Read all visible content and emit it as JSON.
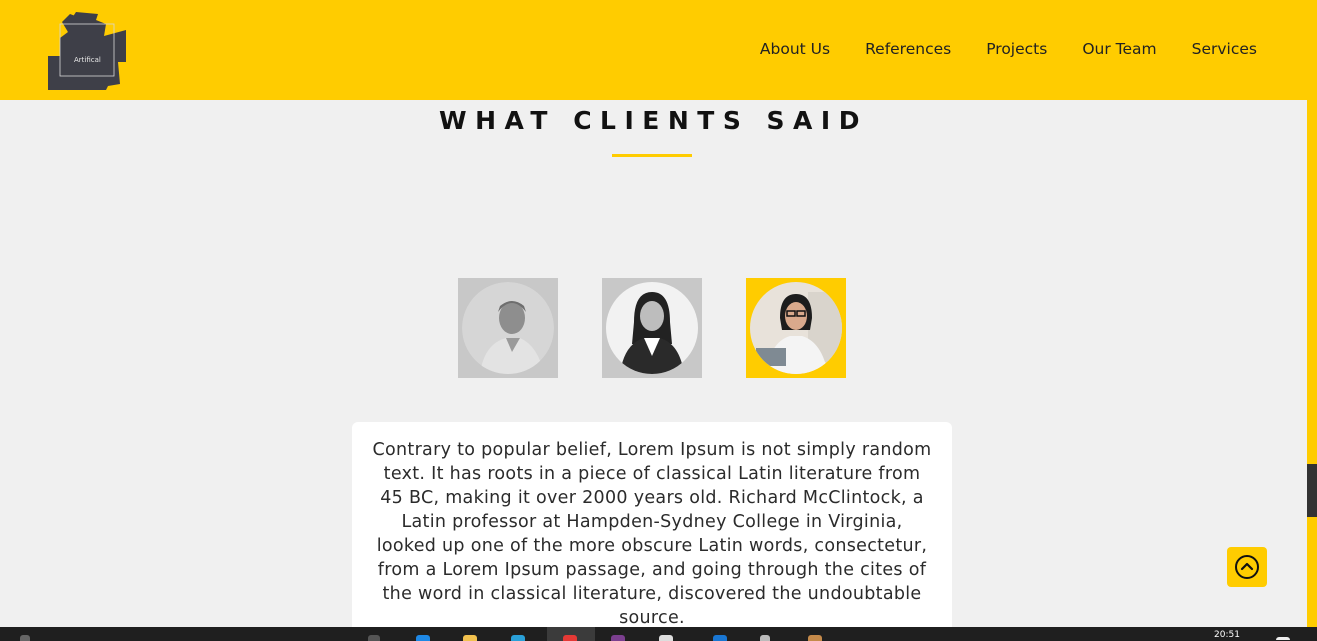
{
  "header": {
    "logo_text": "Artifical",
    "nav": [
      "About Us",
      "References",
      "Projects",
      "Our Team",
      "Services"
    ]
  },
  "section": {
    "title": "WHAT CLIENTS SAID"
  },
  "testimonials": {
    "active_index": 2,
    "quote": "Contrary to popular belief, Lorem Ipsum is not simply random text. It has roots in a piece of classical Latin literature from 45 BC, making it over 2000 years old. Richard McClintock, a Latin professor at Hampden-Sydney College in Virginia, looked up one of the more obscure Latin words, consectetur, from a Lorem Ipsum passage, and going through the cites of the word in classical literature, discovered the undoubtable source."
  },
  "taskbar": {
    "clock": "20:51"
  },
  "colors": {
    "accent": "#ffcc00",
    "dark": "#3e3f48",
    "background": "#f0f0f0"
  }
}
